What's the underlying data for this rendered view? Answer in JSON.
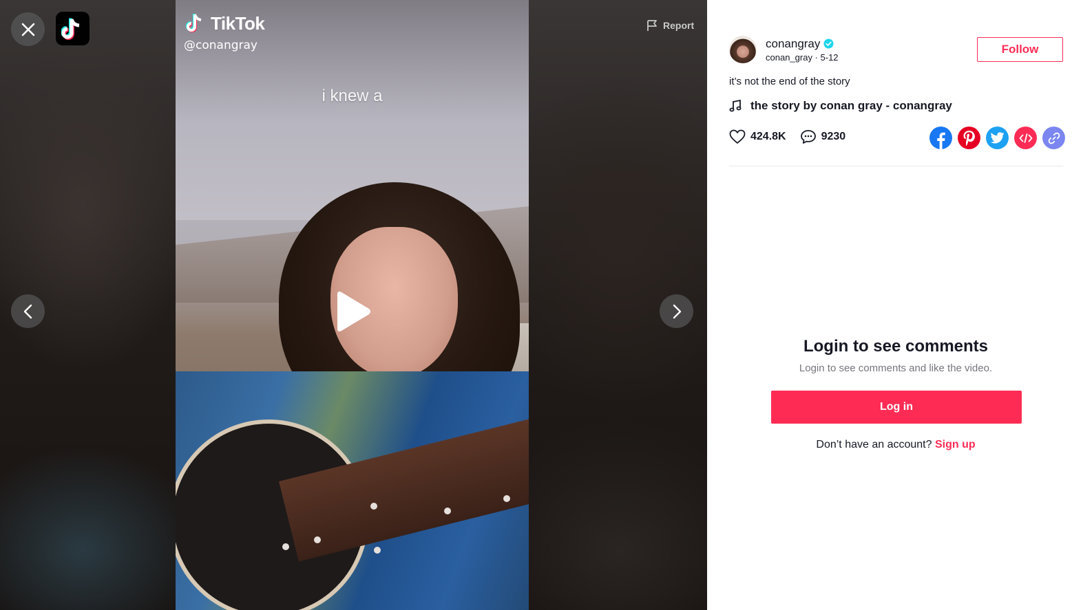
{
  "colors": {
    "brand": "#fe2c55",
    "facebook": "#1877f2",
    "pinterest": "#e60023",
    "twitter": "#1da1f2",
    "embed": "#fe2c55",
    "link": "#7b86f0",
    "verified": "#20d5ec"
  },
  "video": {
    "watermark_logo_text": "TikTok",
    "watermark_handle": "@conangray",
    "caption_overlay": "i knew a",
    "play_icon": "play-icon",
    "report_label": "Report",
    "close_icon": "close-icon",
    "prev_icon": "chevron-left-icon",
    "next_icon": "chevron-right-icon"
  },
  "author": {
    "name": "conangray",
    "verified": true,
    "username": "conan_gray",
    "separator": " · ",
    "date": "5-12",
    "follow_label": "Follow"
  },
  "post": {
    "description": "it’s not the end of the story",
    "music": "the story by conan gray - conangray",
    "likes": "424.8K",
    "comments": "9230"
  },
  "share": {
    "icons": [
      "facebook-icon",
      "pinterest-icon",
      "twitter-icon",
      "embed-icon",
      "link-icon"
    ]
  },
  "login": {
    "title": "Login to see comments",
    "subtitle": "Login to see comments and like the video.",
    "button": "Log in",
    "no_account": "Don’t have an account? ",
    "signup": "Sign up"
  }
}
